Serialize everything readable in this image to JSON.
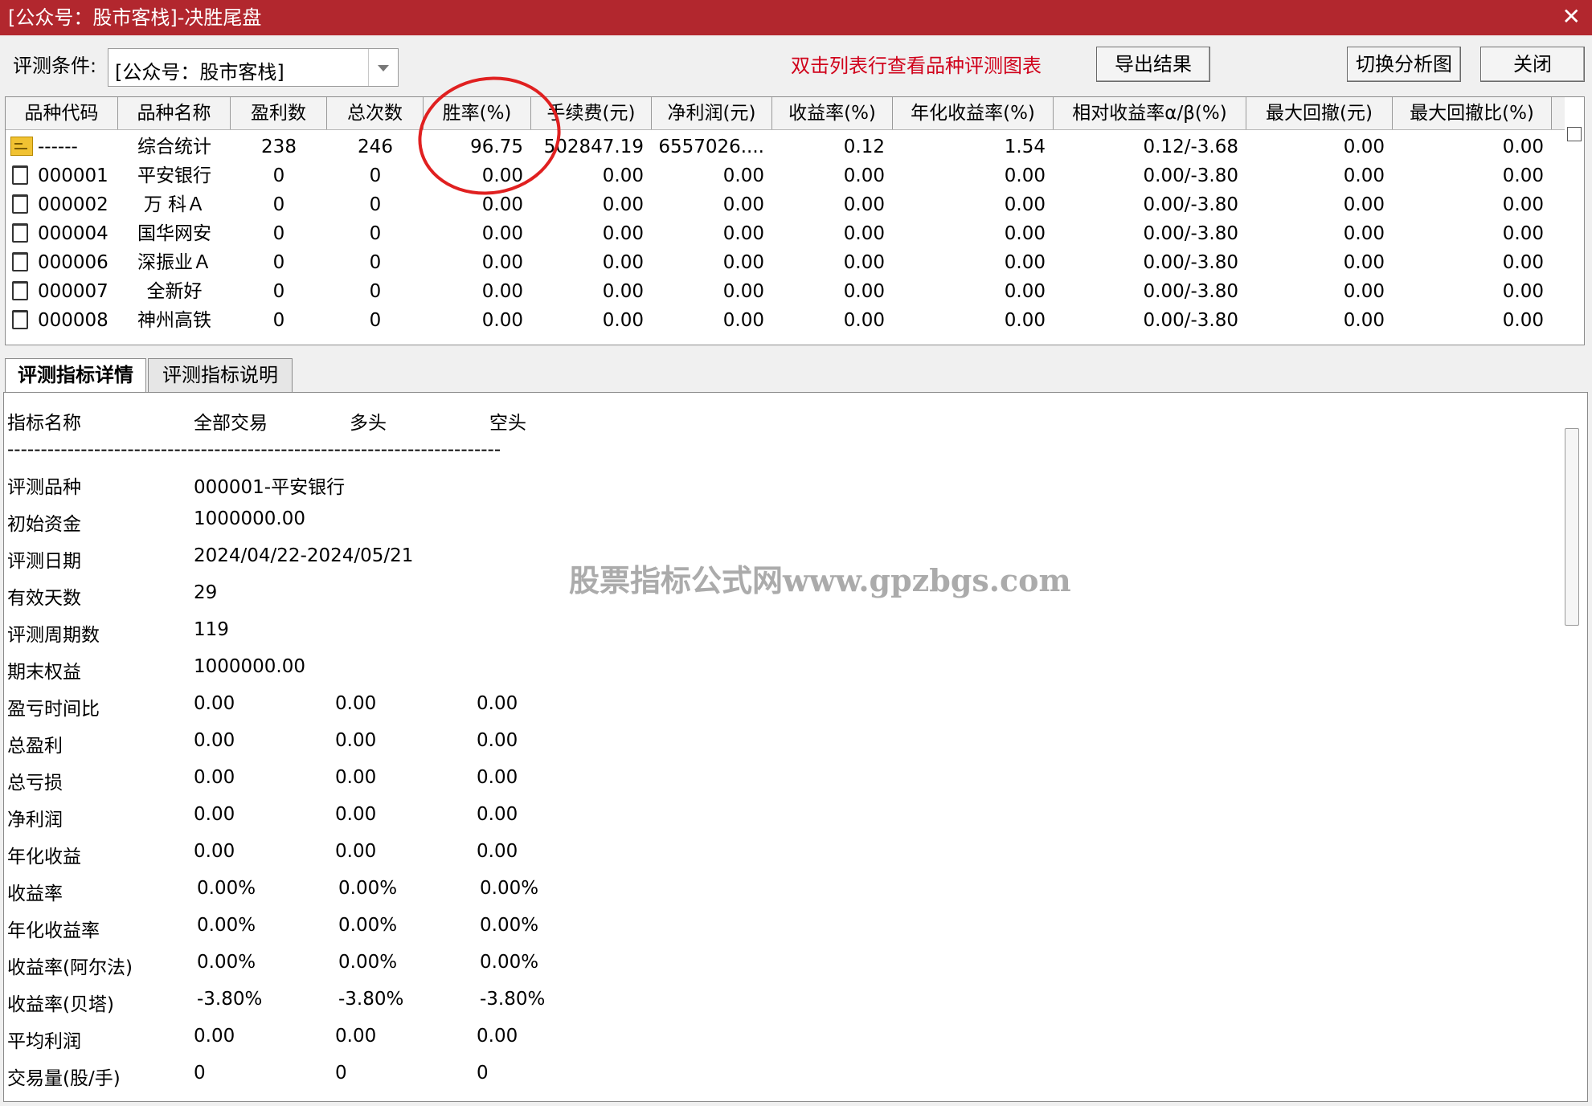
{
  "window": {
    "title": "[公众号：股市客栈]-决胜尾盘"
  },
  "toolbar": {
    "condition_label": "评测条件:",
    "condition_value": "[公众号：股市客栈]",
    "hint": "双击列表行查看品种评测图表",
    "export_label": "导出结果",
    "switch_label": "切换分析图",
    "close_label": "关闭"
  },
  "grid": {
    "headers": [
      "品种代码",
      "品种名称",
      "盈利数",
      "总次数",
      "胜率(%)",
      "手续费(元)",
      "净利润(元)",
      "收益率(%)",
      "年化收益率(%)",
      "相对收益率α/β(%)",
      "最大回撤(元)",
      "最大回撤比(%)"
    ],
    "rows": [
      [
        "------",
        "综合统计",
        "238",
        "246",
        "96.75",
        "502847.19",
        "6557026....",
        "0.12",
        "1.54",
        "0.12/-3.68",
        "0.00",
        "0.00"
      ],
      [
        "000001",
        "平安银行",
        "0",
        "0",
        "0.00",
        "0.00",
        "0.00",
        "0.00",
        "0.00",
        "0.00/-3.80",
        "0.00",
        "0.00"
      ],
      [
        "000002",
        "万 科Ａ",
        "0",
        "0",
        "0.00",
        "0.00",
        "0.00",
        "0.00",
        "0.00",
        "0.00/-3.80",
        "0.00",
        "0.00"
      ],
      [
        "000004",
        "国华网安",
        "0",
        "0",
        "0.00",
        "0.00",
        "0.00",
        "0.00",
        "0.00",
        "0.00/-3.80",
        "0.00",
        "0.00"
      ],
      [
        "000006",
        "深振业Ａ",
        "0",
        "0",
        "0.00",
        "0.00",
        "0.00",
        "0.00",
        "0.00",
        "0.00/-3.80",
        "0.00",
        "0.00"
      ],
      [
        "000007",
        "全新好",
        "0",
        "0",
        "0.00",
        "0.00",
        "0.00",
        "0.00",
        "0.00",
        "0.00/-3.80",
        "0.00",
        "0.00"
      ],
      [
        "000008",
        "神州高铁",
        "0",
        "0",
        "0.00",
        "0.00",
        "0.00",
        "0.00",
        "0.00",
        "0.00/-3.80",
        "0.00",
        "0.00"
      ]
    ]
  },
  "tabs": {
    "detail": "评测指标详情",
    "explain": "评测指标说明"
  },
  "detail": {
    "header": [
      "指标名称",
      "全部交易",
      "多头",
      "空头"
    ],
    "divider": "--------------------------------------------------------------------------",
    "info": [
      [
        "评测品种",
        "000001-平安银行"
      ],
      [
        "初始资金",
        "1000000.00"
      ],
      [
        "评测日期",
        "2024/04/22-2024/05/21"
      ],
      [
        "有效天数",
        "29"
      ],
      [
        "评测周期数",
        "119"
      ],
      [
        "期末权益",
        "1000000.00"
      ]
    ],
    "metrics": [
      [
        "盈亏时间比",
        "0.00",
        "0.00",
        "0.00"
      ],
      [
        "总盈利",
        "0.00",
        "0.00",
        "0.00"
      ],
      [
        "总亏损",
        "0.00",
        "0.00",
        "0.00"
      ],
      [
        "净利润",
        "0.00",
        "0.00",
        "0.00"
      ],
      [
        "年化收益",
        "0.00",
        "0.00",
        "0.00"
      ],
      [
        "收益率",
        "0.00%",
        "0.00%",
        "0.00%"
      ],
      [
        "年化收益率",
        "0.00%",
        "0.00%",
        "0.00%"
      ],
      [
        "收益率(阿尔法)",
        "0.00%",
        "0.00%",
        "0.00%"
      ],
      [
        "收益率(贝塔)",
        "-3.80%",
        "-3.80%",
        "-3.80%"
      ],
      [
        "平均利润",
        "0.00",
        "0.00",
        "0.00"
      ],
      [
        "交易量(股/手)",
        "0",
        "0",
        "0"
      ]
    ]
  },
  "watermark": "股票指标公式网www.gpzbgs.com"
}
